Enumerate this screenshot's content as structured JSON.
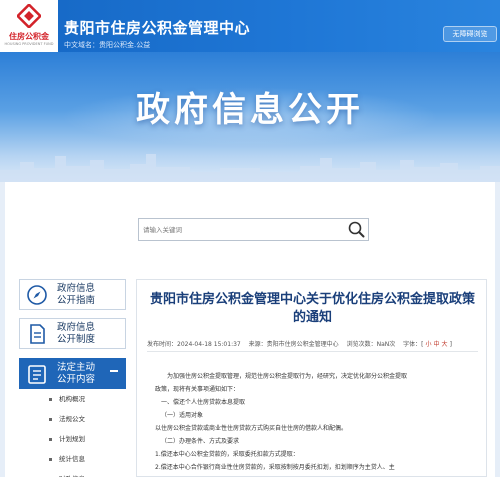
{
  "header": {
    "logo_text": "住房公积金",
    "logo_sub": "HOUSING PROVIDENT FUND",
    "title": "贵阳市住房公积金管理中心",
    "domain": "中文域名：贵阳公积金.公益",
    "accessibility_label": "无障碍浏览"
  },
  "banner": {
    "title": "政府信息公开"
  },
  "search": {
    "placeholder": "请输入关键词"
  },
  "sidebar": {
    "items": [
      {
        "label_line1": "政府信息",
        "label_line2": "公开指南",
        "icon": "compass-icon"
      },
      {
        "label_line1": "政府信息",
        "label_line2": "公开制度",
        "icon": "document-icon"
      },
      {
        "label_line1": "法定主动",
        "label_line2": "公开内容",
        "icon": "checklist-icon"
      }
    ],
    "sub_items": [
      "机构概况",
      "法规公文",
      "计划规划",
      "统计信息",
      "财政信息"
    ]
  },
  "article": {
    "title": "贵阳市住房公积金管理中心关于优化住房公积金提取政策的通知",
    "published": "发布时间：2024-04-18 15:01:37",
    "source": "来源：贵阳市住房公积金管理中心",
    "views": "浏览次数：NaN次",
    "font_label": "字体：[",
    "font_small": "小",
    "font_medium": "中",
    "font_large": "大",
    "font_end": "]",
    "paragraphs": [
      "为加强住房公积金提取管理，规范住房公积金提取行为，经研究，决定优化部分公积金提取",
      "政策，现将有关事项通知如下：",
      "一、偿还个人住房贷款本息提取",
      "（一）适用对象",
      "以住房公积金贷款或商业性住房贷款方式购买自住住房的借款人和配偶。",
      "（二）办理条件、方式及要求",
      "1.偿还本中心公积金贷款的，采取委托扣款方式提取：",
      "2.偿还本中心合作银行商业性住房贷款的，采取按制按月委托扣划，扣划顺序为主贷人、主"
    ]
  },
  "colors": {
    "header_blue": "#1f77d6",
    "sidebar_active": "#1f66b8",
    "title_blue": "#1a3f7a",
    "logo_red": "#d3232a"
  }
}
